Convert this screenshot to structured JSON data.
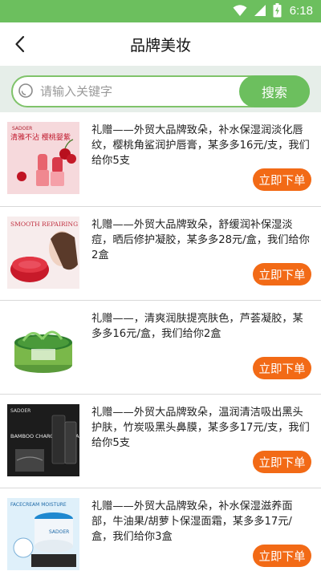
{
  "status_bar": {
    "time": "6:18"
  },
  "header": {
    "title": "品牌美妆",
    "back_icon": "chevron-left-icon"
  },
  "search": {
    "placeholder": "请输入关键字",
    "button_label": "搜索"
  },
  "colors": {
    "brand_green": "#6cbf5e",
    "buy_orange": "#f26a16",
    "page_bg": "#e6eee9"
  },
  "products": [
    {
      "description": "礼赠——外贸大品牌致朵，补水保湿润淡化唇纹，樱桃角鲨润护唇膏，某多多16元/支，我们给你5支",
      "thumb_brand": "SADOER",
      "thumb_text": "清雅不沾 樱桃婴紫",
      "button": "立即下单"
    },
    {
      "description": "礼赠——外贸大品牌致朵，舒缓润补保湿淡痘，晒后修护凝胶，某多多28元/盒，我们给你2盒",
      "thumb_brand": "SMOOTH REPAIRING",
      "thumb_text": "",
      "button": "立即下单"
    },
    {
      "description": "礼赠——，清爽润肤提亮肤色，芦荟凝胶，某多多16元/盒，我们给你2盒",
      "thumb_brand": "",
      "thumb_text": "",
      "button": "立即下单"
    },
    {
      "description": "礼赠——外贸大品牌致朵，温润清洁吸出黑头护肤，竹炭吸黑头鼻膜，某多多17元/支，我们给你5支",
      "thumb_brand": "SADOER",
      "thumb_text": "BAMBOO CHARCOAL CLEAN",
      "button": "立即下单"
    },
    {
      "description": "礼赠——外贸大品牌致朵，补水保湿滋养面部，牛油果/胡萝卜保湿面霜，某多多17元/盒，我们给你3盒",
      "thumb_brand": "SADOER",
      "thumb_text": "FACECREAM MOISTURE",
      "button": "立即下单"
    }
  ]
}
